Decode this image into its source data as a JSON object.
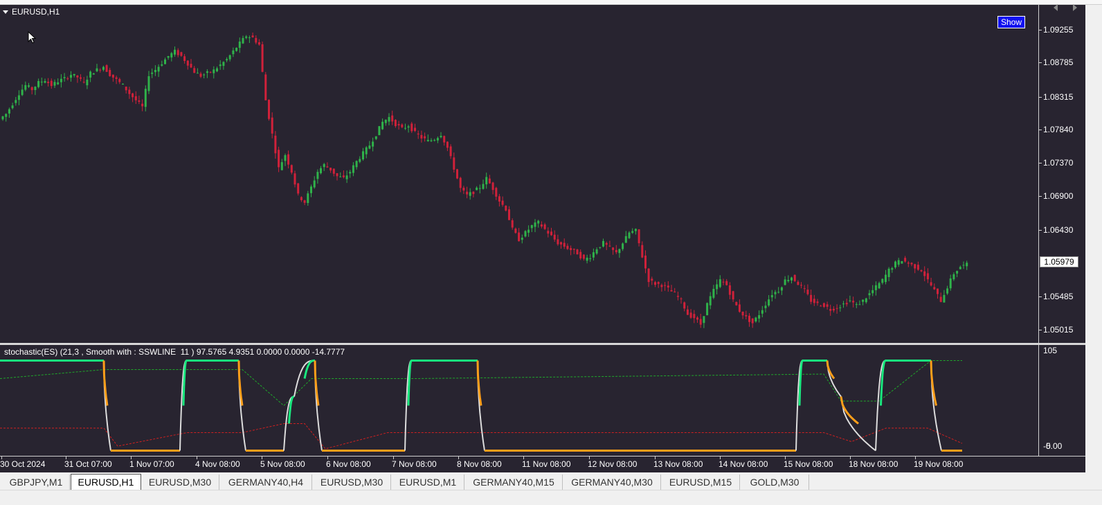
{
  "chart": {
    "title": "EURUSD,H1",
    "show_button": "Show",
    "current_price": "1.05979",
    "price_labels": [
      "1.09255",
      "1.08785",
      "1.08315",
      "1.07840",
      "1.07370",
      "1.06900",
      "1.06430",
      "1.05485",
      "1.05015"
    ],
    "indicator_title": "stochastic(ES) (21,3 , Smooth with : SSWLINE  11 ) 97.5765 4.9351 0.0000 0.0000 -14.7777",
    "indicator_labels": [
      "105",
      "-5",
      "0.00"
    ],
    "time_labels": [
      "30 Oct 2024",
      "31 Oct 07:00",
      "1 Nov 07:00",
      "4 Nov 08:00",
      "5 Nov 08:00",
      "6 Nov 08:00",
      "7 Nov 08:00",
      "8 Nov 08:00",
      "11 Nov 08:00",
      "12 Nov 08:00",
      "13 Nov 08:00",
      "14 Nov 08:00",
      "15 Nov 08:00",
      "18 Nov 08:00",
      "19 Nov 08:00"
    ],
    "colors": {
      "background": "#282430",
      "bull": "#2fb24a",
      "bear": "#d0213a",
      "stoch_up": "#19e87e",
      "stoch_down": "#ff9f1a",
      "stoch_neutral": "#dddddd",
      "signal_up": "#1fa82a",
      "signal_down": "#d02020"
    }
  },
  "tabs": [
    "GBPJPY,M1",
    "EURUSD,H1",
    "EURUSD,M30",
    "GERMANY40,H4",
    "EURUSD,M30",
    "EURUSD,M1",
    "GERMANY40,M15",
    "GERMANY40,M30",
    "EURUSD,M15",
    "GOLD,M30"
  ],
  "active_tab": "EURUSD,H1",
  "chart_data": {
    "type": "candlestick",
    "series": [
      {
        "name": "EURUSD,H1",
        "close": [
          1.082,
          1.0835,
          1.085,
          1.0862,
          1.0856,
          1.0866,
          1.087,
          1.0862,
          1.0868,
          1.0872,
          1.0878,
          1.0874,
          1.0865,
          1.088,
          1.0885,
          1.089,
          1.0878,
          1.087,
          1.0862,
          1.085,
          1.084,
          1.083,
          1.0878,
          1.0885,
          1.0895,
          1.0905,
          1.0912,
          1.0905,
          1.0894,
          1.0882,
          1.0876,
          1.088,
          1.0884,
          1.0892,
          1.09,
          1.0912,
          1.0924,
          1.0935,
          1.0932,
          1.0922,
          1.084,
          1.079,
          1.074,
          1.076,
          1.0735,
          1.07,
          1.069,
          1.0712,
          1.0735,
          1.0745,
          1.0738,
          1.0728,
          1.0725,
          1.0735,
          1.075,
          1.0762,
          1.0774,
          1.079,
          1.0808,
          1.0815,
          1.0805,
          1.0798,
          1.0803,
          1.0792,
          1.0785,
          1.078,
          1.0783,
          1.079,
          1.077,
          1.074,
          1.071,
          1.07,
          1.0705,
          1.0712,
          1.0725,
          1.071,
          1.0692,
          1.068,
          1.065,
          1.0635,
          1.0645,
          1.0655,
          1.066,
          1.065,
          1.064,
          1.063,
          1.0625,
          1.062,
          1.0615,
          1.0605,
          1.061,
          1.0622,
          1.063,
          1.0622,
          1.0615,
          1.063,
          1.0645,
          1.0648,
          1.061,
          1.0575,
          1.057,
          1.0568,
          1.0562,
          1.0555,
          1.0545,
          1.0525,
          1.052,
          1.051,
          1.054,
          1.056,
          1.0575,
          1.0568,
          1.0545,
          1.053,
          1.052,
          1.0512,
          1.0525,
          1.054,
          1.0555,
          1.056,
          1.0575,
          1.058,
          1.057,
          1.056,
          1.0545,
          1.054,
          1.0538,
          1.0532,
          1.0535,
          1.054,
          1.0545,
          1.0538,
          1.0545,
          1.0555,
          1.0565,
          1.0575,
          1.059,
          1.06,
          1.0605,
          1.06,
          1.0595,
          1.059,
          1.0575,
          1.056,
          1.0545,
          1.0565,
          1.0585,
          1.0595,
          1.0598
        ]
      }
    ],
    "price_range": [
      1.0495,
      1.0952
    ],
    "indicator": {
      "name": "stochastic(ES) (21,3 , Smooth with : SSWLINE  11 )",
      "range": [
        -5,
        105
      ],
      "values_shown": [
        97.5765,
        4.9351,
        0.0,
        0.0,
        -14.7777
      ]
    }
  }
}
